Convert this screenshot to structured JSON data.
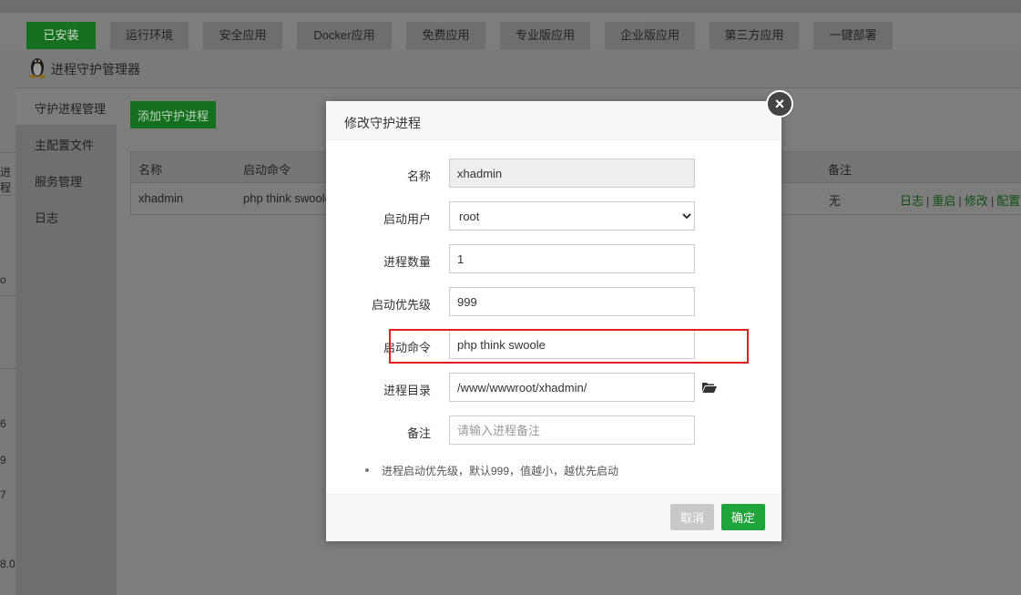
{
  "tabs": [
    "已安装",
    "运行环境",
    "安全应用",
    "Docker应用",
    "免费应用",
    "专业版应用",
    "企业版应用",
    "第三方应用",
    "一键部署"
  ],
  "active_tab_index": 0,
  "left_peek": [
    "进程",
    "o",
    "6",
    "9",
    "7",
    "8.0."
  ],
  "panel": {
    "title": "进程守护管理器",
    "logo_icon": "linux-penguin-icon",
    "sidebar": [
      "守护进程管理",
      "主配置文件",
      "服务管理",
      "日志"
    ],
    "add_button": "添加守护进程",
    "table": {
      "headers": {
        "name": "名称",
        "command": "启动命令",
        "note": "备注"
      },
      "row": {
        "name": "xhadmin",
        "command": "php think swoole",
        "note": "无"
      },
      "ops": [
        "日志",
        "重启",
        "修改",
        "配置文"
      ]
    }
  },
  "modal": {
    "title": "修改守护进程",
    "close_icon": "close-icon",
    "fields": {
      "name": {
        "label": "名称",
        "value": "xhadmin"
      },
      "user": {
        "label": "启动用户",
        "value": "root"
      },
      "count": {
        "label": "进程数量",
        "value": "1"
      },
      "priority": {
        "label": "启动优先级",
        "value": "999"
      },
      "command": {
        "label": "启动命令",
        "value": "php think swoole"
      },
      "dir": {
        "label": "进程目录",
        "value": "/www/wwwroot/xhadmin/"
      },
      "note": {
        "label": "备注",
        "placeholder": "请输入进程备注"
      }
    },
    "folder_icon": "folder-open-icon",
    "tip": "进程启动优先级，默认999，值越小，越优先启动",
    "cancel_label": "取消",
    "ok_label": "确定"
  },
  "colors": {
    "accent_green": "#20a53a",
    "highlight_red": "#e02020"
  }
}
